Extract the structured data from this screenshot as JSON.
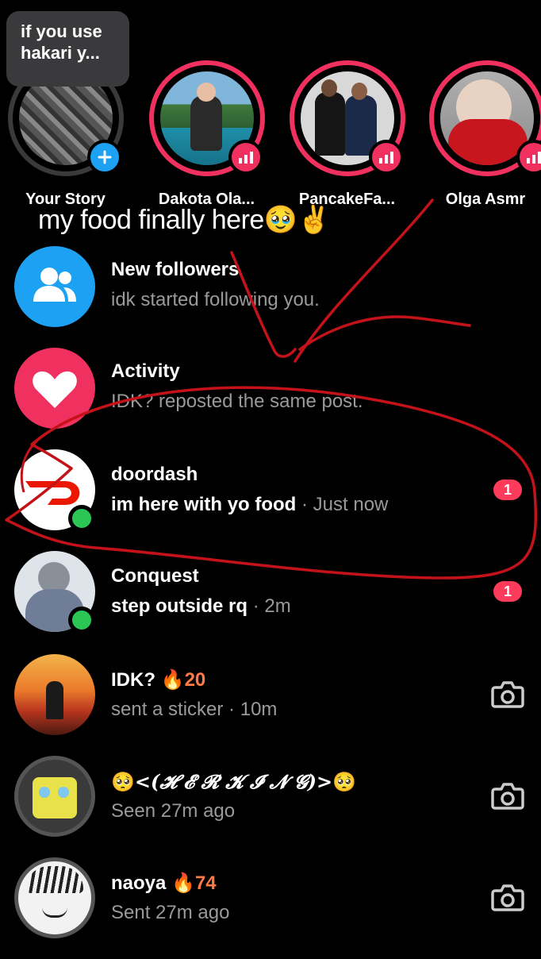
{
  "tooltip": {
    "text": "if you use hakari y..."
  },
  "caption": {
    "text": "my food finally here🥹✌️"
  },
  "stories": [
    {
      "name": "Your Story"
    },
    {
      "name": "Dakota Ola..."
    },
    {
      "name": "PancakeFa..."
    },
    {
      "name": "Olga Asmr"
    }
  ],
  "rows": [
    {
      "title": "New followers",
      "subtitle": "idk started following you."
    },
    {
      "title": "Activity",
      "subtitle": "IDK? reposted the same post."
    },
    {
      "title": "doordash",
      "message": "im here with yo food",
      "time": "· Just now",
      "badge": "1"
    },
    {
      "title": "Conquest",
      "message": "step outside rq",
      "time": "· 2m",
      "badge": "1"
    },
    {
      "title": "IDK?",
      "streak": "20",
      "subtitle": "sent a sticker · 10m"
    },
    {
      "title": "<(𝓗 𝓔 𝓡 𝓚 𝓘 𝓝 𝓖)>",
      "subtitle": "Seen 27m ago"
    },
    {
      "title": "naoya",
      "streak": "74",
      "subtitle": "Sent 27m ago"
    }
  ],
  "colors": {
    "accent": "#f0305f",
    "blue": "#1da1f2",
    "online": "#2bc654",
    "annotation": "#c4121a"
  }
}
